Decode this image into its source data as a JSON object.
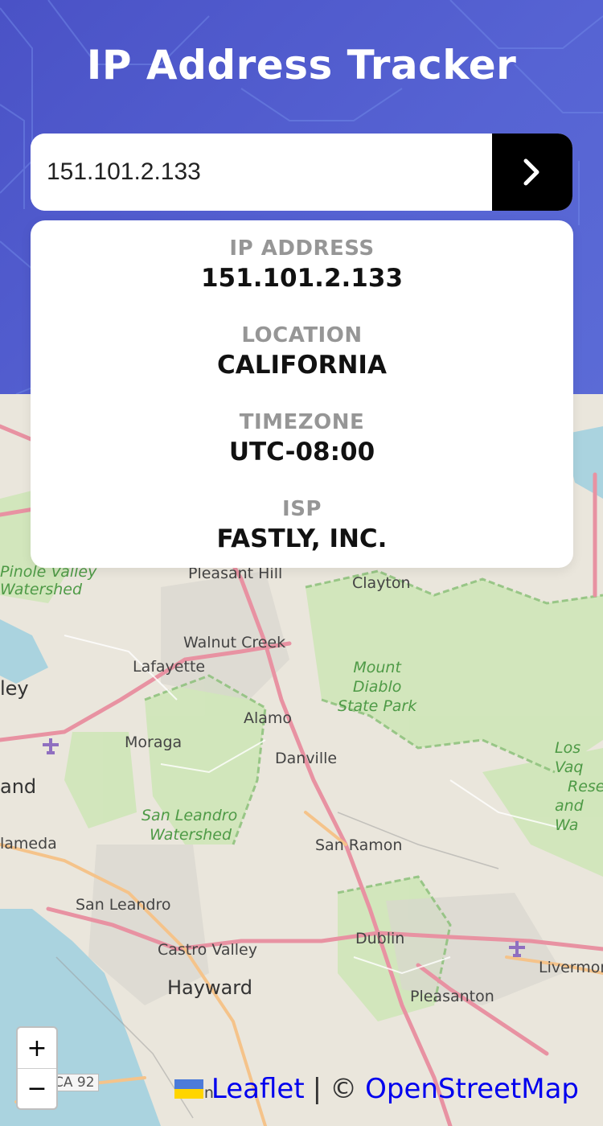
{
  "header": {
    "title": "IP Address Tracker"
  },
  "search": {
    "value": "151.101.2.133",
    "button_icon": "chevron-right-icon"
  },
  "info": {
    "ip_label": "IP ADDRESS",
    "ip_value": "151.101.2.133",
    "location_label": "LOCATION",
    "location_value": "CALIFORNIA",
    "timezone_label": "TIMEZONE",
    "timezone_value": "UTC-08:00",
    "isp_label": "ISP",
    "isp_value": "FASTLY, INC."
  },
  "map": {
    "places": {
      "pinole": "Pinole Valley",
      "watershed1": "Watershed",
      "pleasant_hill": "Pleasant Hill",
      "clayton": "Clayton",
      "walnut_creek": "Walnut Creek",
      "lafayette": "Lafayette",
      "mount": "Mount",
      "diablo": "Diablo",
      "state_park": "State Park",
      "valley": "ley",
      "alamo": "Alamo",
      "moraga": "Moraga",
      "danville": "Danville",
      "los_vaq": "Los Vaq",
      "reser": "Reser",
      "and_wa": "and Wa",
      "oakland": "and",
      "san_leandro_ws": "San Leandro",
      "watershed2": "Watershed",
      "alameda": "lameda",
      "san_ramon": "San Ramon",
      "san_leandro": "San Leandro",
      "dublin": "Dublin",
      "castro_valley": "Castro Valley",
      "livermore": "Livermor",
      "hayward": "Hayward",
      "pleasanton": "Pleasanton",
      "ca92": "CA 92",
      "union": "Un"
    },
    "zoom_in": "+",
    "zoom_out": "−",
    "attr_leaflet": "Leaflet",
    "attr_sep": "|",
    "attr_copy": "©",
    "attr_osm": "OpenStreetMap"
  },
  "colors": {
    "header_bg": "#5663d3",
    "button_bg": "#000000",
    "label": "#969696"
  }
}
